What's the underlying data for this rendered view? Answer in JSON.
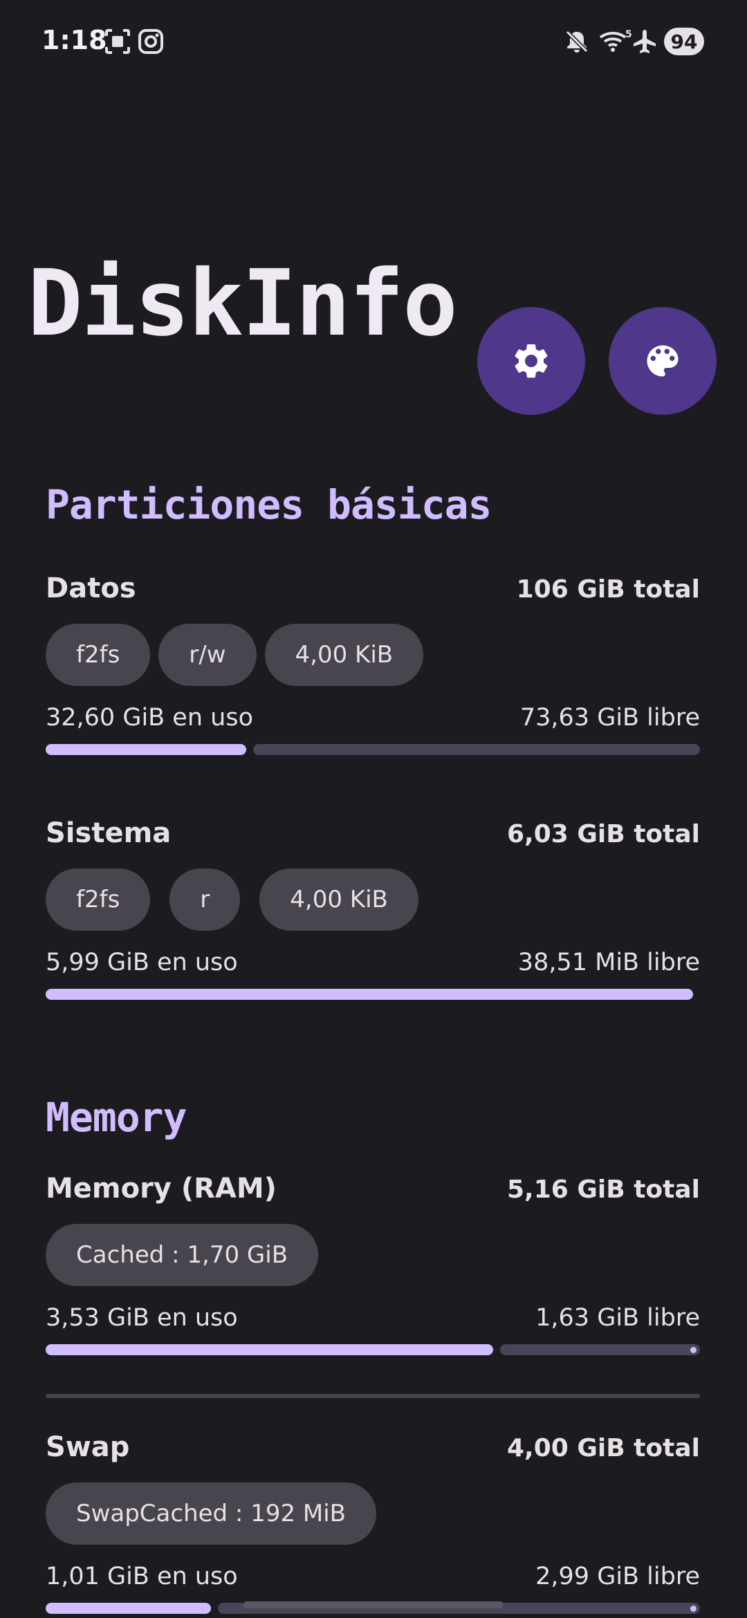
{
  "status": {
    "time": "1:18",
    "battery": "94"
  },
  "app": {
    "title": "DiskInfo"
  },
  "buttons": {
    "settings": "settings-icon",
    "theme": "palette-icon"
  },
  "sections": {
    "partitions": {
      "title": "Particiones básicas",
      "datos": {
        "name": "Datos",
        "total": "106 GiB total",
        "chips": [
          "f2fs",
          "r/w",
          "4,00 KiB"
        ],
        "used": "32,60 GiB en uso",
        "free": "73,63 GiB libre",
        "used_fraction": 0.307
      },
      "sistema": {
        "name": "Sistema",
        "total": "6,03 GiB total",
        "chips": [
          "f2fs",
          "r",
          "4,00 KiB"
        ],
        "used": "5,99 GiB en uso",
        "free": "38,51 MiB libre",
        "used_fraction": 0.994
      }
    },
    "memory": {
      "title": "Memory",
      "ram": {
        "name": "Memory (RAM)",
        "total": "5,16 GiB total",
        "chips": [
          "Cached : 1,70 GiB"
        ],
        "used": "3,53 GiB en uso",
        "free": "1,63 GiB libre",
        "used_fraction": 0.684
      },
      "swap": {
        "name": "Swap",
        "total": "4,00 GiB total",
        "chips": [
          "SwapCached : 192 MiB"
        ],
        "used": "1,01 GiB en uso",
        "free": "2,99 GiB libre",
        "used_fraction": 0.2525
      }
    }
  },
  "colors": {
    "accent": "#d0bcff",
    "fab": "#4f378b",
    "background": "#1c1b1f",
    "chip": "#49454f"
  }
}
